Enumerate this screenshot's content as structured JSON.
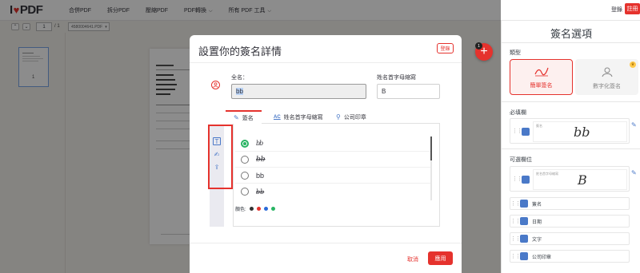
{
  "nav": {
    "links": [
      "合併PDF",
      "拆分PDF",
      "壓縮PDF",
      "PDF轉換",
      "所有 PDF 工具"
    ],
    "login": "登錄",
    "signup": "註冊"
  },
  "toolbar": {
    "page_current": "1",
    "page_total": "/ 1",
    "file_name": "4580004641.PDF"
  },
  "thumbs": {
    "page_number": "1"
  },
  "fab": {
    "badge": "1",
    "plus": "+"
  },
  "modal": {
    "title": "設置你的簽名詳情",
    "login_button": "登錄",
    "full_name_label": "全名：",
    "full_name_value": "bb",
    "initials_label": "姓名首字母縮寫",
    "initials_value": "B",
    "tabs": [
      {
        "label": "簽名",
        "icon": "pen-icon"
      },
      {
        "label": "姓名首字母縮寫",
        "icon": "ac-icon"
      },
      {
        "label": "公司印章",
        "icon": "stamp-icon"
      }
    ],
    "options": [
      {
        "text": "bb",
        "style": "script1",
        "selected": true
      },
      {
        "text": "bb",
        "style": "script2",
        "selected": false
      },
      {
        "text": "bb",
        "style": "plain",
        "selected": false
      },
      {
        "text": "bb",
        "style": "script3",
        "selected": false
      }
    ],
    "color_label": "顏色:",
    "colors": [
      "#333333",
      "#e5322d",
      "#2a6ad9",
      "#28b463"
    ],
    "cancel": "取消",
    "apply": "應用"
  },
  "right_panel": {
    "title": "簽名選項",
    "type_label": "類型",
    "type_simple": "簡單簽名",
    "type_digital": "數字化簽名",
    "required_label": "必填欄",
    "required_field_small": "簽名",
    "required_field_sig": "bb",
    "optional_label": "可選欄位",
    "optional_initial_small": "姓名首字母縮寫",
    "optional_initial_sig": "B",
    "fields": [
      "簽名",
      "日期",
      "文字",
      "公司印章"
    ]
  },
  "accent_color": "#e5322d"
}
